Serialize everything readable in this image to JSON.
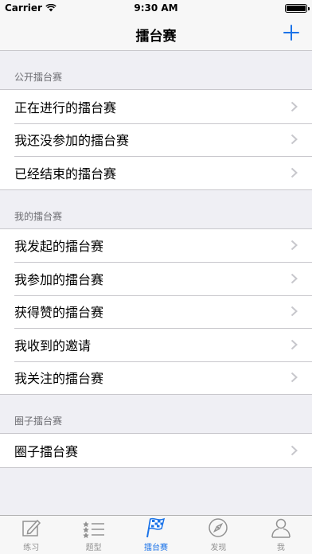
{
  "status_bar": {
    "carrier": "Carrier",
    "time": "9:30 AM"
  },
  "nav": {
    "title": "擂台赛",
    "add_icon": "plus-icon"
  },
  "sections": [
    {
      "header": "公开擂台赛",
      "items": [
        "正在进行的擂台赛",
        "我还没参加的擂台赛",
        "已经结束的擂台赛"
      ]
    },
    {
      "header": "我的擂台赛",
      "items": [
        "我发起的擂台赛",
        "我参加的擂台赛",
        "获得赞的擂台赛",
        "我收到的邀请",
        "我关注的擂台赛"
      ]
    },
    {
      "header": "圈子擂台赛",
      "items": [
        "圈子擂台赛"
      ]
    }
  ],
  "tabs": [
    {
      "label": "练习",
      "icon": "pencil-icon"
    },
    {
      "label": "题型",
      "icon": "list-icon"
    },
    {
      "label": "擂台赛",
      "icon": "flag-icon",
      "active": true
    },
    {
      "label": "发现",
      "icon": "compass-icon"
    },
    {
      "label": "我",
      "icon": "person-icon"
    }
  ],
  "colors": {
    "accent": "#1b73e8",
    "background": "#efeff4",
    "separator": "#c8c7cc"
  }
}
